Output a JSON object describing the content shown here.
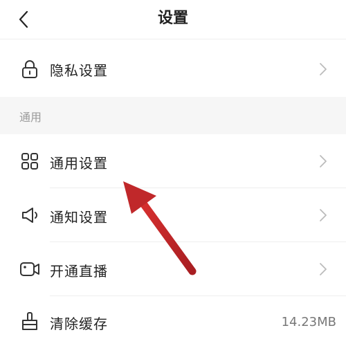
{
  "header": {
    "title": "设置",
    "back_icon": "chevron-left-icon"
  },
  "privacy": {
    "label": "隐私设置",
    "icon": "lock-icon"
  },
  "section": {
    "title": "通用"
  },
  "general": {
    "label": "通用设置",
    "icon": "grid-icon"
  },
  "notify": {
    "label": "通知设置",
    "icon": "speaker-icon"
  },
  "live": {
    "label": "开通直播",
    "icon": "video-camera-icon"
  },
  "cache": {
    "label": "清除缓存",
    "icon": "broom-icon",
    "size": "14.23MB"
  },
  "colors": {
    "annotation_arrow": "#c0282a",
    "section_bg": "#f6f6f6",
    "text": "#222222"
  }
}
